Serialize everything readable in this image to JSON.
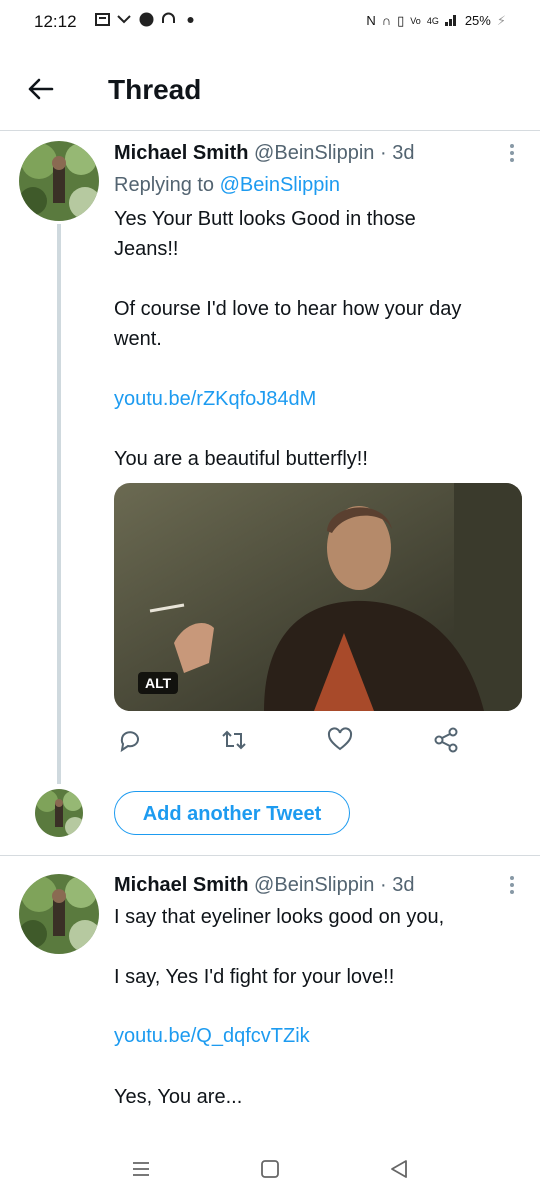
{
  "status_bar": {
    "time": "12:12",
    "battery": "25%",
    "network": "4G"
  },
  "header": {
    "title": "Thread",
    "back_icon": "arrow-left-icon"
  },
  "tweets": [
    {
      "author_name": "Michael Smith",
      "handle": "@BeinSlippin",
      "age": "· 3d",
      "replying_label": "Replying to",
      "replying_handle": "@BeinSlippin",
      "paragraph1_line1": "Yes Your Butt looks Good in those",
      "paragraph1_line2": "Jeans!!",
      "paragraph2_line1": "Of course I'd love to hear how your day",
      "paragraph2_line2": "went.",
      "link": "youtu.be/rZKqfoJ84dM",
      "paragraph3": "You are a beautiful butterfly!!",
      "media_alt_badge": "ALT"
    },
    {
      "author_name": "Michael Smith",
      "handle": "@BeinSlippin",
      "age": "· 3d",
      "paragraph1": "I say that eyeliner looks good on you,",
      "paragraph2": "I say, Yes I'd fight for your love!!",
      "link": "youtu.be/Q_dqfcvTZik",
      "paragraph3": "Yes, You are..."
    }
  ],
  "compose": {
    "add_button_label": "Add another Tweet"
  },
  "colors": {
    "accent": "#1d9bf0",
    "text": "#0f1419",
    "secondary_text": "#536471",
    "divider": "#d6dbdf"
  }
}
